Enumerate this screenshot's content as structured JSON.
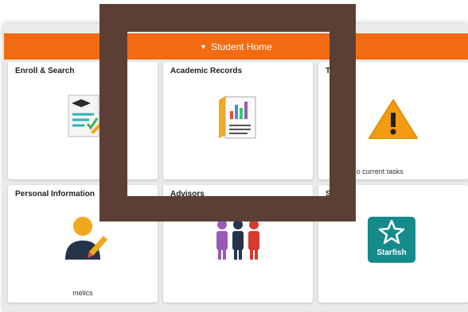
{
  "header": {
    "caret": "▼",
    "title": "Student Home"
  },
  "tiles": [
    {
      "name": "enroll-search",
      "title": "Enroll & Search",
      "footer": ""
    },
    {
      "name": "academic-records",
      "title": "Academic Records",
      "footer": ""
    },
    {
      "name": "tasks",
      "title": "T",
      "footer": "No current tasks"
    },
    {
      "name": "personal-information",
      "title": "Personal Information",
      "footer": "melics"
    },
    {
      "name": "advisors",
      "title": "Advisors",
      "footer": ""
    },
    {
      "name": "starfish",
      "title": "S",
      "footer": "",
      "logo_text": "Starfish"
    }
  ],
  "colors": {
    "accent": "#f26b12",
    "frame": "#5b3f35",
    "warning": "#f39c12",
    "starfish": "#158b8c"
  },
  "icons": {
    "enroll": "enroll-checklist-icon",
    "records": "records-chart-icon",
    "tasks": "warning-icon",
    "personal": "person-pencil-icon",
    "advisors": "people-group-icon",
    "starfish": "starfish-logo-icon"
  }
}
